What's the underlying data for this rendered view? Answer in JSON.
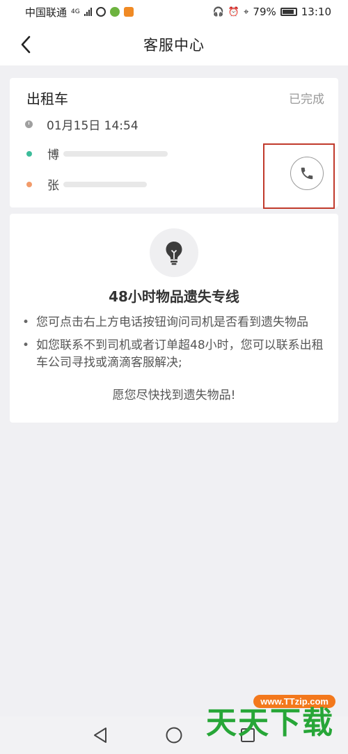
{
  "status_bar": {
    "carrier": "中国联通",
    "network": "4G",
    "battery": "79%",
    "time": "13:10"
  },
  "header": {
    "title": "客服中心"
  },
  "trip": {
    "type": "出租车",
    "status": "已完成",
    "datetime": "01月15日 14:54",
    "pickup": "博",
    "dropoff": "张"
  },
  "lost_items": {
    "title": "48小时物品遗失专线",
    "bullets": [
      "您可点击右上方电话按钮询问司机是否看到遗失物品",
      "如您联系不到司机或者订单超48小时，您可以联系出租车公司寻找或滴滴客服解决;"
    ],
    "closing": "愿您尽快找到遗失物品!"
  },
  "watermark": {
    "url": "www.TTzip.com",
    "text": "天天下载"
  },
  "colors": {
    "accent_green": "#3dbc9a",
    "accent_orange": "#f29b6a",
    "highlight_red": "#c0392b"
  }
}
